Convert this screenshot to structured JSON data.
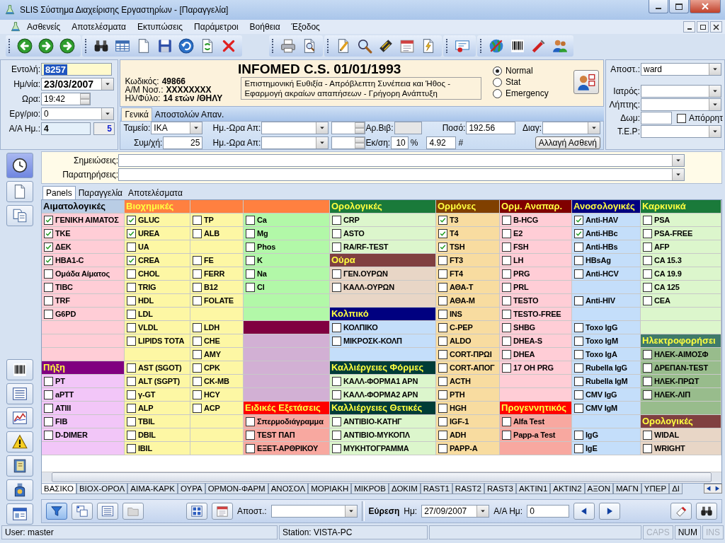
{
  "window": {
    "title": "SLIS Σύστημα Διαχείρισης Εργαστηρίων - [Παραγγελία]"
  },
  "menu": [
    "Ασθενείς",
    "Αποτελέσματα",
    "Εκτυπώσεις",
    "Παράμετροι",
    "Βοήθεια",
    "Έξοδος"
  ],
  "patient_panel": [
    {
      "kind": "selected_text",
      "label": "Εντολή:",
      "value": "8257"
    },
    {
      "kind": "combo",
      "label": "Ημ/νία:",
      "value": "23/03/2007"
    },
    {
      "kind": "spin",
      "label": "Ωρα:",
      "value": "19:42"
    },
    {
      "kind": "combo",
      "label": "Εργ/ριο:",
      "value": "0"
    },
    {
      "kind": "pair",
      "label": "Α/Α Ημ.:",
      "value": "4",
      "extra": "5"
    }
  ],
  "header": {
    "title": "INFOMED C.S. 01/01/1993",
    "info": [
      {
        "label": "Κωδικός:",
        "value": "49866"
      },
      {
        "label": "Α/Μ Νοσ.:",
        "value": "XXXXXXXX"
      },
      {
        "label": "Ηλ/Φύλο:",
        "value": "14 ετών /ΘΗΛΥ"
      }
    ],
    "motto": "Επιστημονική Ευθιξία - Απρόβλεπτη Συνέπεια και Ήθος - Εφαρμογή ακραίων απαπήσεων - Γρήγορη Ανάπτυξη",
    "priority": [
      {
        "label": "Normal",
        "selected": true
      },
      {
        "label": "Stat",
        "selected": false
      },
      {
        "label": "Emergency",
        "selected": false
      }
    ]
  },
  "form_tabs": [
    {
      "label": "Γενικά",
      "selected": true
    },
    {
      "label": "Αποστολών Απαν.",
      "selected": false
    }
  ],
  "form_rows": [
    [
      {
        "kind": "combo",
        "label": "Ταμείο:",
        "value": "ΙΚΑ"
      },
      {
        "kind": "combo",
        "label": "Ημ.-Ωρα Απ:"
      },
      {
        "kind": "spin"
      },
      {
        "kind": "readonly",
        "label": "Αρ.Βιβ:"
      },
      {
        "kind": "text",
        "label": "Ποσό:",
        "value": "192.56"
      },
      {
        "kind": "combo",
        "label": "Διαγ:"
      }
    ],
    [
      {
        "kind": "text",
        "label": "Συμ/χή:",
        "value": "25"
      },
      {
        "kind": "combo",
        "label": "Ημ.-Ωρα Απ:"
      },
      {
        "kind": "spin"
      },
      {
        "kind": "text",
        "label": "Εκ/ση:",
        "value": "10",
        "unit": "%"
      },
      {
        "kind": "text",
        "value": "4.92",
        "unit": "#"
      },
      {
        "kind": "button",
        "label": "Αλλαγή Ασθενή"
      }
    ]
  ],
  "side_panel": [
    {
      "kind": "combo",
      "label": "Αποστ.:",
      "value": "ward"
    },
    {
      "kind": "combo",
      "label": "Ιατρός:"
    },
    {
      "kind": "combo",
      "label": "Λήπτης:"
    },
    {
      "kind": "text_check",
      "label": "Δωμ:",
      "check_label": "Απόρρητ",
      "checked": false
    },
    {
      "kind": "combo",
      "label": "Τ.Ε.Ρ:"
    }
  ],
  "notes": [
    {
      "label": "Σημειώσεις:"
    },
    {
      "label": "Παρατηρήσεις:"
    }
  ],
  "panel_tabs": [
    {
      "label": "Panels",
      "selected": true
    },
    {
      "label": "Παραγγελία",
      "selected": false
    },
    {
      "label": "Αποτελέσματα",
      "selected": false
    }
  ],
  "panels": [
    {
      "sections": [
        {
          "header": {
            "title": "Αιματολογικές",
            "color": "#b9cde5"
          },
          "color": "#ffcdd6",
          "cells": [
            {
              "kind": "test",
              "label": "ΓΕΝΙΚΗ ΑΙΜΑΤΟΣ",
              "checked": true
            },
            {
              "kind": "test",
              "label": "ΤΚΕ",
              "checked": true
            },
            {
              "kind": "test",
              "label": "ΔΕΚ",
              "checked": true
            },
            {
              "kind": "test",
              "label": "HBA1-C",
              "checked": true
            },
            {
              "kind": "test",
              "label": "Ομάδα Αίματος",
              "checked": false
            },
            {
              "kind": "test",
              "label": "TIBC",
              "checked": false
            },
            {
              "kind": "test",
              "label": "TRF",
              "checked": false
            },
            {
              "kind": "test",
              "label": "G6PD",
              "checked": false
            },
            {
              "kind": "blank"
            },
            {
              "kind": "blank"
            },
            {
              "kind": "blank"
            }
          ]
        },
        {
          "header": {
            "title": "Πήξη",
            "color": "#800080"
          },
          "color": "#f2c6f8",
          "cells": [
            {
              "kind": "test",
              "label": "PT",
              "checked": false
            },
            {
              "kind": "test",
              "label": "aPTT",
              "checked": false
            },
            {
              "kind": "test",
              "label": "ATIII",
              "checked": false
            },
            {
              "kind": "test",
              "label": "FIB",
              "checked": false
            },
            {
              "kind": "test",
              "label": "D-DIMER",
              "checked": false
            },
            {
              "kind": "blank"
            }
          ]
        }
      ]
    },
    {
      "sections": [
        {
          "header": {
            "title": "Βιοχημικές",
            "color": "#ff8040"
          },
          "color": "#fdf7a4",
          "cells": [
            {
              "kind": "test",
              "label": "GLUC",
              "checked": true
            },
            {
              "kind": "test",
              "label": "UREA",
              "checked": true
            },
            {
              "kind": "test",
              "label": "UA",
              "checked": false
            },
            {
              "kind": "test",
              "label": "CREA",
              "checked": true
            },
            {
              "kind": "test",
              "label": "CHOL",
              "checked": false
            },
            {
              "kind": "test",
              "label": "TRIG",
              "checked": false
            },
            {
              "kind": "test",
              "label": "HDL",
              "checked": false
            },
            {
              "kind": "test",
              "label": "LDL",
              "checked": false
            },
            {
              "kind": "test",
              "label": "VLDL",
              "checked": false
            },
            {
              "kind": "test",
              "label": "LIPIDS TOTA",
              "checked": false
            },
            {
              "kind": "blank"
            },
            {
              "kind": "test",
              "label": "AST (SGOT)",
              "checked": false
            },
            {
              "kind": "test",
              "label": "ALT (SGPT)",
              "checked": false
            },
            {
              "kind": "test",
              "label": "γ-GT",
              "checked": false
            },
            {
              "kind": "test",
              "label": "ALP",
              "checked": false
            },
            {
              "kind": "test",
              "label": "TBIL",
              "checked": false
            },
            {
              "kind": "test",
              "label": "DBIL",
              "checked": false
            },
            {
              "kind": "test",
              "label": "IBIL",
              "checked": false
            }
          ]
        }
      ]
    },
    {
      "sections": [
        {
          "header": {
            "color": "#ff8040"
          },
          "color": "#fdf7a4",
          "cells": [
            {
              "kind": "test",
              "label": "TP",
              "checked": false
            },
            {
              "kind": "test",
              "label": "ALB",
              "checked": false
            },
            {
              "kind": "blank"
            },
            {
              "kind": "test",
              "label": "FE",
              "checked": false
            },
            {
              "kind": "test",
              "label": "FERR",
              "checked": false
            },
            {
              "kind": "test",
              "label": "B12",
              "checked": false
            },
            {
              "kind": "test",
              "label": "FOLATE",
              "checked": false
            },
            {
              "kind": "blank"
            },
            {
              "kind": "test",
              "label": "LDH",
              "checked": false
            },
            {
              "kind": "test",
              "label": "CHE",
              "checked": false
            },
            {
              "kind": "test",
              "label": "AMY",
              "checked": false
            },
            {
              "kind": "test",
              "label": "CPK",
              "checked": false
            },
            {
              "kind": "test",
              "label": "CK-MB",
              "checked": false
            },
            {
              "kind": "test",
              "label": "HCY",
              "checked": false
            },
            {
              "kind": "test",
              "label": "ACP",
              "checked": false
            },
            {
              "kind": "blank"
            },
            {
              "kind": "blank"
            },
            {
              "kind": "blank"
            }
          ]
        }
      ]
    },
    {
      "sections": [
        {
          "header": {
            "color": "#ff8040"
          },
          "color": "#b2f8a8",
          "cells": [
            {
              "kind": "test",
              "label": "Ca",
              "checked": false
            },
            {
              "kind": "test",
              "label": "Mg",
              "checked": false
            },
            {
              "kind": "test",
              "label": "Phos",
              "checked": false
            },
            {
              "kind": "test",
              "label": "K",
              "checked": false
            },
            {
              "kind": "test",
              "label": "Na",
              "checked": false
            },
            {
              "kind": "test",
              "label": "Cl",
              "checked": false
            },
            {
              "kind": "blank"
            },
            {
              "kind": "blank"
            }
          ]
        },
        {
          "header": {
            "color": "#800040"
          },
          "color": "#d2b0d4",
          "cells": [
            {
              "kind": "blank"
            },
            {
              "kind": "blank"
            },
            {
              "kind": "blank"
            },
            {
              "kind": "blank"
            },
            {
              "kind": "blank"
            }
          ]
        },
        {
          "header": {
            "title": "Ειδικές Εξετάσεις",
            "color": "#ff0000"
          },
          "color": "#f8a8a0",
          "cells": [
            {
              "kind": "test",
              "label": "Σπερμοδιάγραμμα",
              "checked": false
            },
            {
              "kind": "test",
              "label": "TEST ΠΑΠ",
              "checked": false
            },
            {
              "kind": "test",
              "label": "ΕΞΕΤ-ΑΡΘΡΙΚΟΥ",
              "checked": false
            }
          ]
        }
      ]
    },
    {
      "sections": [
        {
          "header": {
            "title": "Ορολογικές",
            "color": "#1a7a3a"
          },
          "color": "#dcf6cc",
          "cells": [
            {
              "kind": "test",
              "label": "CRP",
              "checked": false
            },
            {
              "kind": "test",
              "label": "ASTO",
              "checked": false
            },
            {
              "kind": "test",
              "label": "RA/RF-TEST",
              "checked": false
            }
          ]
        },
        {
          "header": {
            "title": "Ούρα",
            "color": "#804040"
          },
          "color": "#e8d6c6",
          "cells": [
            {
              "kind": "test",
              "label": "ΓΕΝ.ΟΥΡΩΝ",
              "checked": false
            },
            {
              "kind": "test",
              "label": "ΚΑΛΛ-ΟΥΡΩΝ",
              "checked": false
            },
            {
              "kind": "blank"
            }
          ]
        },
        {
          "header": {
            "title": "Κολπικό",
            "color": "#000080"
          },
          "color": "#c4defa",
          "cells": [
            {
              "kind": "test",
              "label": "ΚΟΛΠΙΚΟ",
              "checked": false
            },
            {
              "kind": "test",
              "label": "ΜΙΚΡΟΣΚ-ΚΟΛΠ",
              "checked": false
            },
            {
              "kind": "blank"
            }
          ]
        },
        {
          "header": {
            "title": "Καλλιέργειες Φόρμες",
            "color": "#003c38"
          },
          "color": "#dcf6cc",
          "cells": [
            {
              "kind": "test",
              "label": "ΚΑΛΛ-ΦΟΡΜΑ1 ΑΡΝ",
              "checked": false
            },
            {
              "kind": "test",
              "label": "ΚΑΛΛ-ΦΟΡΜΑ2 ΑΡΝ",
              "checked": false
            }
          ]
        },
        {
          "header": {
            "title": "Καλλιέργειες Θετικές",
            "color": "#003c38"
          },
          "color": "#dcf6cc",
          "cells": [
            {
              "kind": "test",
              "label": "ΑΝΤΙΒΙΟ-ΚΑΤΗΓ",
              "checked": false
            },
            {
              "kind": "test",
              "label": "ΑΝΤΙΒΙΟ-ΜΥΚΟΠΛ",
              "checked": false
            },
            {
              "kind": "test",
              "label": "ΜΥΚΗΤΟΓΡΑΜΜΑ",
              "checked": false
            }
          ]
        }
      ]
    },
    {
      "sections": [
        {
          "header": {
            "title": "Ορμόνες",
            "color": "#804000"
          },
          "color": "#f8dca0",
          "cells": [
            {
              "kind": "test",
              "label": "T3",
              "checked": true
            },
            {
              "kind": "test",
              "label": "T4",
              "checked": true
            },
            {
              "kind": "test",
              "label": "TSH",
              "checked": true
            },
            {
              "kind": "test",
              "label": "FT3",
              "checked": false
            },
            {
              "kind": "test",
              "label": "FT4",
              "checked": false
            },
            {
              "kind": "test",
              "label": "ΑΘΑ-Τ",
              "checked": false
            },
            {
              "kind": "test",
              "label": "ΑΘΑ-Μ",
              "checked": false
            },
            {
              "kind": "test",
              "label": "INS",
              "checked": false
            },
            {
              "kind": "test",
              "label": "C-PEP",
              "checked": false
            },
            {
              "kind": "test",
              "label": "ALDO",
              "checked": false
            },
            {
              "kind": "test",
              "label": "CORT-ΠΡΩΙ",
              "checked": false
            },
            {
              "kind": "test",
              "label": "CORT-ΑΠΟΓ",
              "checked": false
            },
            {
              "kind": "test",
              "label": "ACTH",
              "checked": false
            },
            {
              "kind": "test",
              "label": "PTH",
              "checked": false
            },
            {
              "kind": "test",
              "label": "HGH",
              "checked": false
            },
            {
              "kind": "test",
              "label": "IGF-1",
              "checked": false
            },
            {
              "kind": "test",
              "label": "ADH",
              "checked": false
            },
            {
              "kind": "test",
              "label": "PAPP-A",
              "checked": false
            }
          ]
        }
      ]
    },
    {
      "sections": [
        {
          "header": {
            "title": "Ορμ. Αναπαρ.",
            "color": "#800000"
          },
          "color": "#ffcdd6",
          "cells": [
            {
              "kind": "test",
              "label": "B-HCG",
              "checked": false
            },
            {
              "kind": "test",
              "label": "E2",
              "checked": false
            },
            {
              "kind": "test",
              "label": "FSH",
              "checked": false
            },
            {
              "kind": "test",
              "label": "LH",
              "checked": false
            },
            {
              "kind": "test",
              "label": "PRG",
              "checked": false
            },
            {
              "kind": "test",
              "label": "PRL",
              "checked": false
            },
            {
              "kind": "test",
              "label": "TESTO",
              "checked": false
            },
            {
              "kind": "test",
              "label": "TESTO-FREE",
              "checked": false
            },
            {
              "kind": "test",
              "label": "SHBG",
              "checked": false
            },
            {
              "kind": "test",
              "label": "DHEA-S",
              "checked": false
            },
            {
              "kind": "test",
              "label": "DHEA",
              "checked": false
            },
            {
              "kind": "test",
              "label": "17 OH PRG",
              "checked": false
            },
            {
              "kind": "blank"
            },
            {
              "kind": "blank"
            }
          ]
        },
        {
          "header": {
            "title": "Προγεννητικός",
            "color": "#ff0000"
          },
          "color": "#f8a8a0",
          "cells": [
            {
              "kind": "test",
              "label": "Alfa Test",
              "checked": false
            },
            {
              "kind": "test",
              "label": "Papp-a Test",
              "checked": false
            },
            {
              "kind": "blank"
            }
          ]
        }
      ]
    },
    {
      "sections": [
        {
          "header": {
            "title": "Ανοσολογικές",
            "color": "#000080"
          },
          "color": "#c4defa",
          "cells": [
            {
              "kind": "test",
              "label": "Anti-HAV",
              "checked": true
            },
            {
              "kind": "test",
              "label": "Anti-HBc",
              "checked": true
            },
            {
              "kind": "test",
              "label": "Anti-HBs",
              "checked": false
            },
            {
              "kind": "test",
              "label": "HBsAg",
              "checked": false
            },
            {
              "kind": "test",
              "label": "Anti-HCV",
              "checked": false
            },
            {
              "kind": "blank"
            },
            {
              "kind": "test",
              "label": "Anti-HIV",
              "checked": false
            },
            {
              "kind": "blank"
            },
            {
              "kind": "test",
              "label": "Toxo IgG",
              "checked": false
            },
            {
              "kind": "test",
              "label": "Toxo IgM",
              "checked": false
            },
            {
              "kind": "test",
              "label": "Toxo IgA",
              "checked": false
            },
            {
              "kind": "test",
              "label": "Rubella IgG",
              "checked": false
            },
            {
              "kind": "test",
              "label": "Rubella IgM",
              "checked": false
            },
            {
              "kind": "test",
              "label": "CMV IgG",
              "checked": false
            },
            {
              "kind": "test",
              "label": "CMV IgM",
              "checked": false
            },
            {
              "kind": "blank"
            },
            {
              "kind": "test",
              "label": "IgG",
              "checked": false
            },
            {
              "kind": "test",
              "label": "IgE",
              "checked": false
            }
          ]
        }
      ]
    },
    {
      "sections": [
        {
          "header": {
            "title": "Καρκινικά",
            "color": "#1a7a3a"
          },
          "color": "#dcf6cc",
          "cells": [
            {
              "kind": "test",
              "label": "PSA",
              "checked": false
            },
            {
              "kind": "test",
              "label": "PSA-FREE",
              "checked": false
            },
            {
              "kind": "test",
              "label": "AFP",
              "checked": false
            },
            {
              "kind": "test",
              "label": "CA 15.3",
              "checked": false
            },
            {
              "kind": "test",
              "label": "CA 19.9",
              "checked": false
            },
            {
              "kind": "test",
              "label": "CA 125",
              "checked": false
            },
            {
              "kind": "test",
              "label": "CEA",
              "checked": false
            },
            {
              "kind": "blank"
            },
            {
              "kind": "blank"
            }
          ]
        },
        {
          "header": {
            "title": "Ηλεκτροφορήσει",
            "color": "#3f7a6a"
          },
          "color": "#98bc8c",
          "cells": [
            {
              "kind": "test",
              "label": "ΗΛΕΚ-ΑΙΜΟΣΦ",
              "checked": false
            },
            {
              "kind": "test",
              "label": "ΔΡΕΠΑΝ-TEST",
              "checked": false
            },
            {
              "kind": "test",
              "label": "ΗΛΕΚ-ΠΡΩΤ",
              "checked": false
            },
            {
              "kind": "test",
              "label": "ΗΛΕΚ-ΛΙΠ",
              "checked": false
            },
            {
              "kind": "blank"
            }
          ]
        },
        {
          "header": {
            "title": "Ορολογικές",
            "color": "#804040"
          },
          "color": "#e8d6c6",
          "cells": [
            {
              "kind": "test",
              "label": "WIDAL",
              "checked": false
            },
            {
              "kind": "test",
              "label": "WRIGHT",
              "checked": false
            }
          ]
        }
      ]
    }
  ],
  "bottom_tabs": [
    {
      "label": "ΒΑΣΙΚΟ",
      "selected": true
    },
    {
      "label": "ΒΙΟΧ-ΟΡΟΛ",
      "selected": false
    },
    {
      "label": "ΑΙΜΑ-ΚΑΡΚ",
      "selected": false
    },
    {
      "label": "ΟΥΡΑ",
      "selected": false
    },
    {
      "label": "ΟΡΜΟΝ-ΦΑΡΜ",
      "selected": false
    },
    {
      "label": "ΑΝΟΣΟΛ",
      "selected": false
    },
    {
      "label": "ΜΟΡΙΑΚΗ",
      "selected": false
    },
    {
      "label": "ΜΙΚΡΟΒ",
      "selected": false
    },
    {
      "label": "ΔΟΚΙΜ",
      "selected": false
    },
    {
      "label": "RAST1",
      "selected": false
    },
    {
      "label": "RAST2",
      "selected": false
    },
    {
      "label": "RAST3",
      "selected": false
    },
    {
      "label": "ΑΚΤΙΝ1",
      "selected": false
    },
    {
      "label": "ΑΚΤΙΝ2",
      "selected": false
    },
    {
      "label": "ΑΞΟΝ",
      "selected": false
    },
    {
      "label": "ΜΑΓΝ",
      "selected": false
    },
    {
      "label": "ΥΠΕΡ",
      "selected": false
    },
    {
      "label": "ΔΙ",
      "selected": false
    }
  ],
  "bottom_bar": {
    "sender_label": "Αποστ.:",
    "search_label": "Εύρεση",
    "date_label": "Ημ:",
    "date": "27/09/2007",
    "aa_label": "Α/Α Ημ:",
    "aa": "0"
  },
  "status_bar": {
    "user": "User: master",
    "station": "Station: VISTA-PC",
    "keys": [
      {
        "label": "CAPS",
        "on": false
      },
      {
        "label": "NUM",
        "on": true
      },
      {
        "label": "INS",
        "on": false
      }
    ]
  }
}
